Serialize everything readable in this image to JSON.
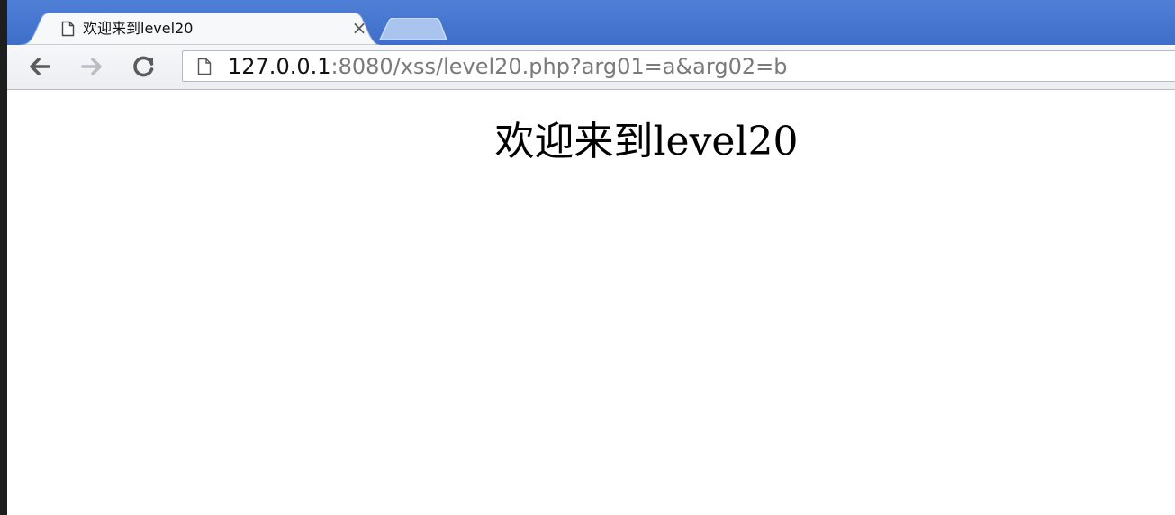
{
  "browser": {
    "tab": {
      "title": "欢迎来到level20",
      "close_glyph": "×",
      "favicon": "page-icon"
    },
    "new_tab": {
      "icon": "new-tab-icon"
    },
    "toolbar": {
      "back_icon": "back-arrow-icon",
      "forward_icon": "forward-arrow-icon",
      "reload_icon": "reload-icon"
    },
    "address_bar": {
      "host": "127.0.0.1",
      "rest": ":8080/xss/level20.php?arg01=a&arg02=b",
      "page_icon": "page-icon"
    },
    "colors": {
      "tabstrip": "#4a79d2",
      "tab_active": "#f7f8fa",
      "new_tab": "#a9c4ef"
    }
  },
  "page": {
    "heading": "欢迎来到level20"
  }
}
